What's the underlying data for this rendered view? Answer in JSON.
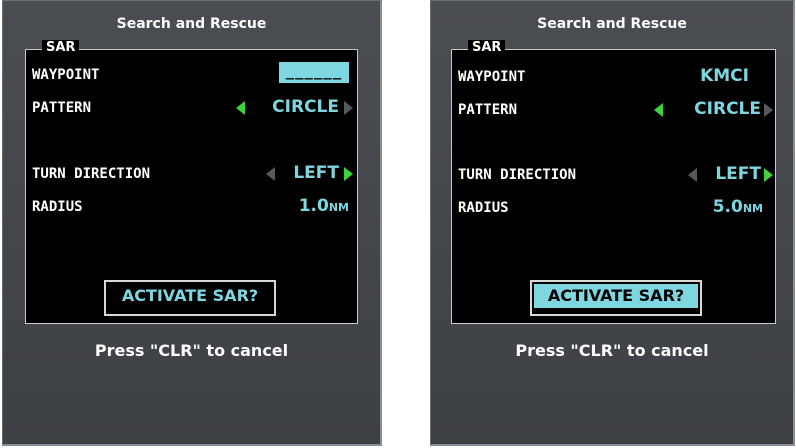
{
  "left_panel": {
    "title": "Search and Rescue",
    "group_label": "SAR",
    "waypoint": {
      "label": "WAYPOINT",
      "value": "______"
    },
    "pattern": {
      "label": "PATTERN",
      "value": "CIRCLE"
    },
    "turn_direction": {
      "label": "TURN DIRECTION",
      "value": "LEFT"
    },
    "radius": {
      "label": "RADIUS",
      "value": "1.0",
      "unit": "NM"
    },
    "activate_button": "ACTIVATE SAR?",
    "hint": "Press \"CLR\" to cancel"
  },
  "right_panel": {
    "title": "Search and Rescue",
    "group_label": "SAR",
    "waypoint": {
      "label": "WAYPOINT",
      "value": "KMCI"
    },
    "pattern": {
      "label": "PATTERN",
      "value": "CIRCLE"
    },
    "turn_direction": {
      "label": "TURN DIRECTION",
      "value": "LEFT"
    },
    "radius": {
      "label": "RADIUS",
      "value": "5.0",
      "unit": "NM"
    },
    "activate_button": "ACTIVATE SAR?",
    "hint": "Press \"CLR\" to cancel"
  },
  "colors": {
    "value_cyan": "#7ed6e0",
    "arrow_active": "#3fd13f",
    "arrow_inactive": "#555a5e",
    "panel_bg": "#45484d"
  }
}
